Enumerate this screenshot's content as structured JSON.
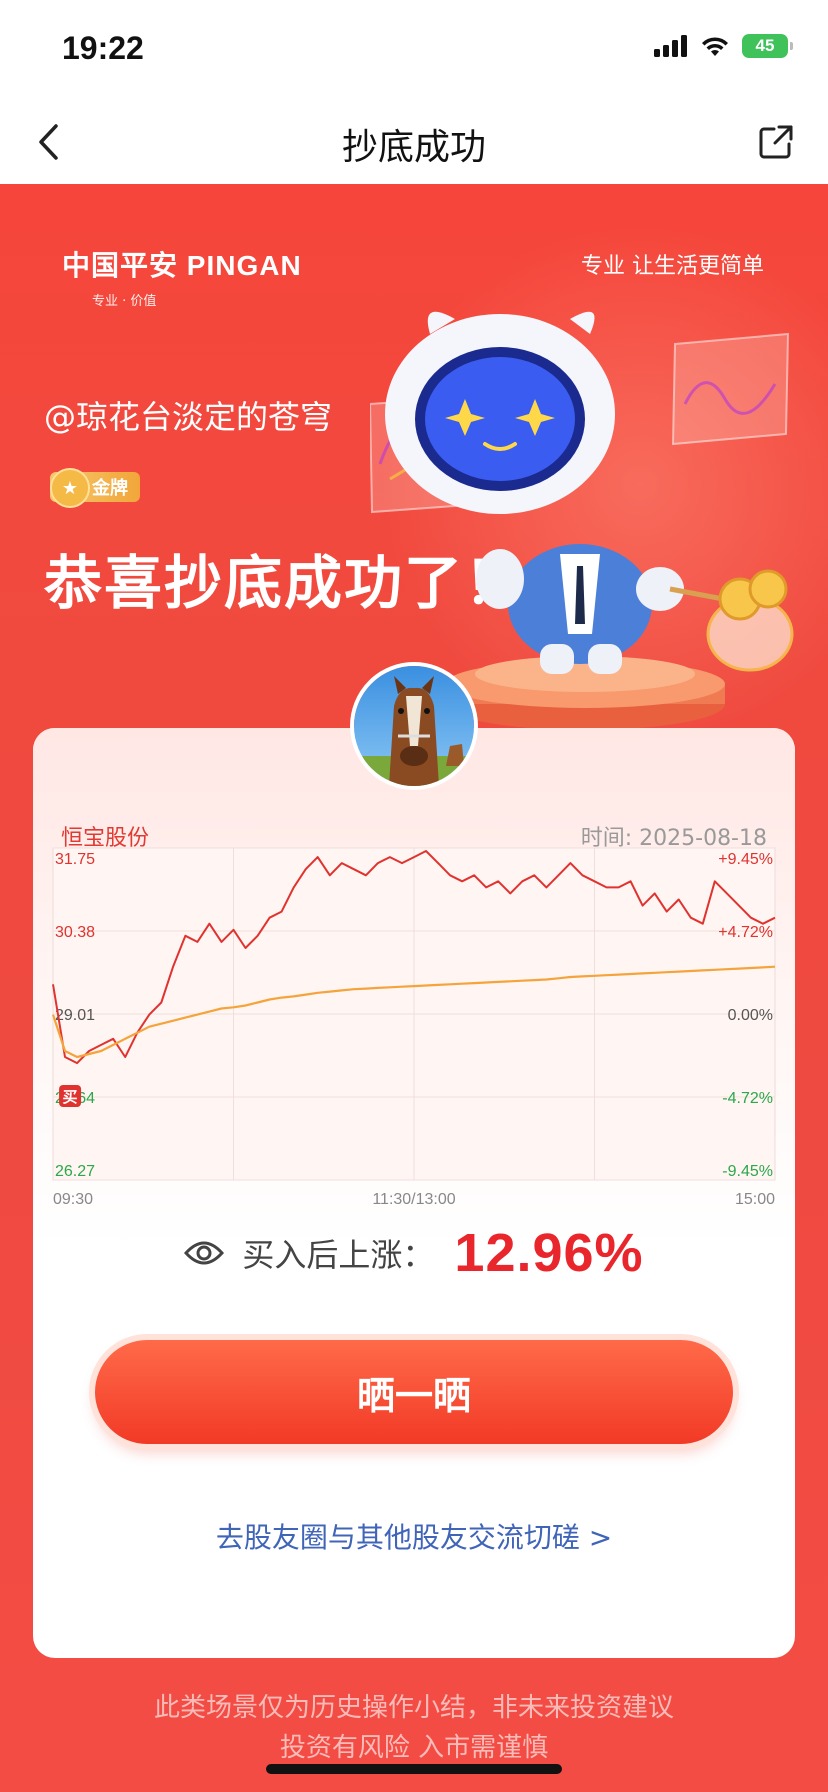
{
  "status": {
    "time": "19:22",
    "battery": "45"
  },
  "nav": {
    "title": "抄底成功"
  },
  "brand": {
    "name": "中国平安 PINGAN",
    "tagline": "专业 · 价值",
    "slogan": "专业 让生活更简单"
  },
  "user": {
    "handle": "@琼花台淡定的苍穹",
    "badge": "金牌"
  },
  "headline": "恭喜抄底成功了！",
  "stock": {
    "name": "恒宝股份",
    "date": "时间: 2025-08-18"
  },
  "chart_data": {
    "type": "line",
    "x_ticks": [
      "09:30",
      "11:30/13:00",
      "15:00"
    ],
    "y_ticks": [
      "31.75",
      "30.38",
      "29.01",
      "27.64",
      "26.27"
    ],
    "pct_ticks": [
      "+9.45%",
      "+4.72%",
      "0.00%",
      "-4.72%",
      "-9.45%"
    ],
    "ylim": [
      26.27,
      31.75
    ],
    "base": 29.01,
    "buy_marker": "买",
    "series": [
      {
        "values": [
          29.5,
          28.3,
          28.2,
          28.4,
          28.5,
          28.6,
          28.3,
          28.7,
          29.0,
          29.2,
          29.8,
          30.3,
          30.2,
          30.5,
          30.2,
          30.4,
          30.1,
          30.3,
          30.6,
          30.7,
          31.1,
          31.4,
          31.6,
          31.3,
          31.5,
          31.4,
          31.3,
          31.5,
          31.6,
          31.5,
          31.6,
          31.7,
          31.5,
          31.3,
          31.2,
          31.3,
          31.1,
          31.2,
          31.0,
          31.2,
          31.3,
          31.1,
          31.3,
          31.5,
          31.3,
          31.2,
          31.1,
          31.1,
          31.2,
          30.8,
          31.0,
          30.7,
          30.9,
          30.6,
          30.5,
          31.2,
          31.0,
          30.8,
          30.6,
          30.5,
          30.6
        ],
        "color": "#e0332f"
      },
      {
        "values": [
          29.0,
          28.4,
          28.3,
          28.35,
          28.4,
          28.5,
          28.6,
          28.7,
          28.8,
          28.85,
          28.9,
          28.95,
          29.0,
          29.05,
          29.1,
          29.12,
          29.15,
          29.2,
          29.25,
          29.28,
          29.3,
          29.33,
          29.36,
          29.38,
          29.4,
          29.42,
          29.43,
          29.44,
          29.45,
          29.46,
          29.47,
          29.48,
          29.49,
          29.5,
          29.51,
          29.52,
          29.53,
          29.54,
          29.55,
          29.56,
          29.57,
          29.58,
          29.6,
          29.62,
          29.63,
          29.64,
          29.65,
          29.66,
          29.67,
          29.68,
          29.69,
          29.7,
          29.71,
          29.72,
          29.73,
          29.74,
          29.75,
          29.76,
          29.77,
          29.78,
          29.79
        ],
        "color": "#f4a43a"
      }
    ]
  },
  "gain": {
    "label": "买入后上涨：",
    "value": "12.96%"
  },
  "share_button": "晒一晒",
  "community_link": "去股友圈与其他股友交流切磋 >",
  "disclaimer": {
    "line1": "此类场景仅为历史操作小结，非未来投资建议",
    "line2": "投资有风险 入市需谨慎"
  }
}
